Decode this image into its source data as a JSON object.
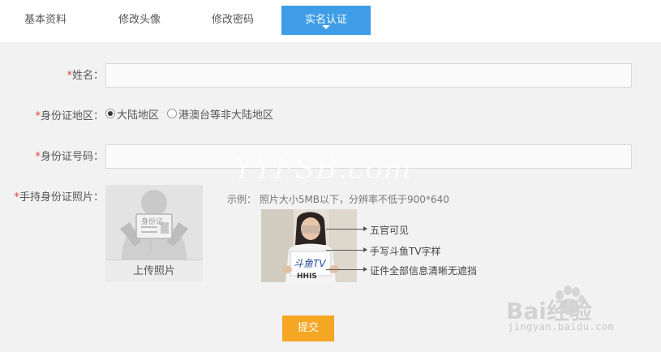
{
  "tabs": [
    {
      "label": "基本资料",
      "active": false
    },
    {
      "label": "修改头像",
      "active": false
    },
    {
      "label": "修改密码",
      "active": false
    },
    {
      "label": "实名认证",
      "active": true
    }
  ],
  "form": {
    "name": {
      "required_mark": "*",
      "label": "姓名：",
      "value": ""
    },
    "region": {
      "required_mark": "*",
      "label": "身份证地区：",
      "options": [
        {
          "label": "大陆地区",
          "checked": true
        },
        {
          "label": "港澳台等非大陆地区",
          "checked": false
        }
      ]
    },
    "id_number": {
      "required_mark": "*",
      "label": "身份证号码：",
      "value": ""
    },
    "photo": {
      "required_mark": "*",
      "label": "手持身份证照片：",
      "upload_label": "上传照片",
      "card_text": "身份证",
      "hint": "示例： 照片大小5MB以下，分辨率不低于900*640",
      "sample_card_text": "斗鱼TV",
      "sample_shirt_text": "HHIS",
      "callouts": [
        "五官可见",
        "手写斗鱼TV字样",
        "证件全部信息清晰无遮挡"
      ]
    }
  },
  "submit_label": "提交",
  "watermark": {
    "site": "YYFSB.com",
    "baidu_logo": "Bai经验",
    "baidu_url": "jingyan.baidu.com"
  },
  "colors": {
    "tab_active": "#3e9de6",
    "panel_bg": "#f2f2f2",
    "required": "#e53b3b",
    "submit": "#f5a623"
  },
  "icons": [
    "chevron-down-icon",
    "person-silhouette-icon",
    "radio-checked-icon",
    "radio-unchecked-icon",
    "arrow-icon",
    "paw-icon"
  ]
}
